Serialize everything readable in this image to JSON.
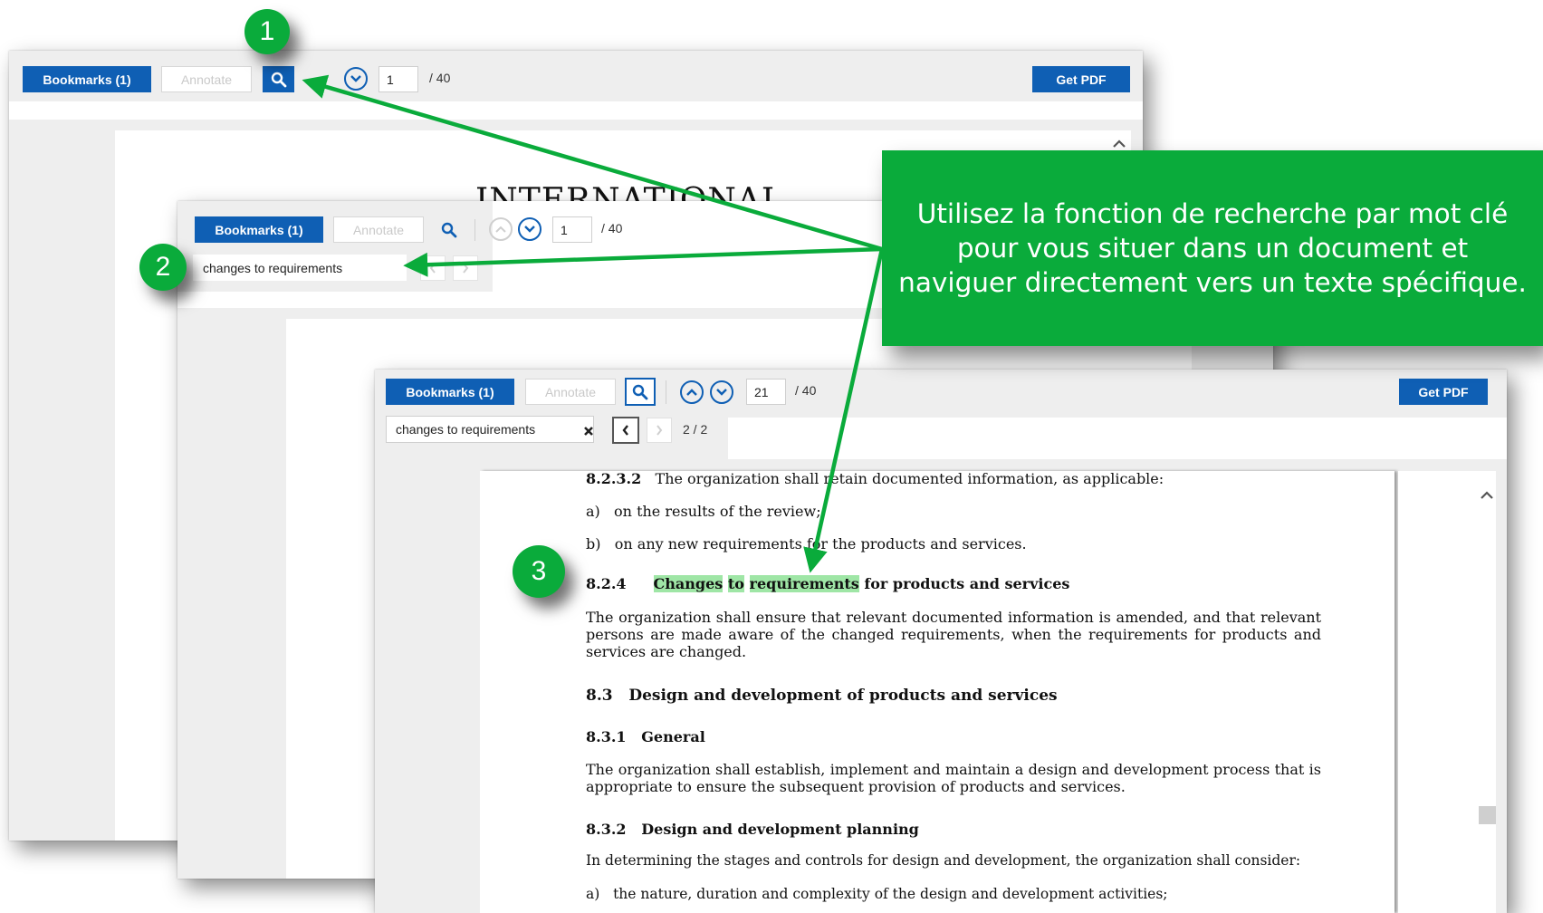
{
  "toolbar": {
    "bookmarks_label": "Bookmarks (1)",
    "annotate_label": "Annotate",
    "get_pdf_label": "Get PDF",
    "page_separator": "/ 40"
  },
  "window1": {
    "page_value": "1",
    "doc_title_fragment": "INTERNATIONAL"
  },
  "window2": {
    "page_value": "1",
    "search_value": "changes to requirements"
  },
  "window3": {
    "page_value": "21",
    "search_value": "changes to requirements",
    "match_count": "2 / 2"
  },
  "document": {
    "l1_num": "8.2.3.2",
    "l1_text": "The organization shall retain documented information, as applicable:",
    "l2_mark": "a)",
    "l2_text": "on the results of the review;",
    "l3_mark": "b)",
    "l3_text": "on any new requirements for the products and services.",
    "h824_num": "8.2.4",
    "h824_hl1": "Changes",
    "h824_hl2": "to",
    "h824_hl3": "requirements",
    "h824_rest": "for products and services",
    "p824": "The organization shall ensure that relevant documented information is amended, and that relevant persons are made aware of the changed requirements, when the requirements for products and services are changed.",
    "h83_num": "8.3",
    "h83_text": "Design and development of products and services",
    "h831_num": "8.3.1",
    "h831_text": "General",
    "p831": "The organization shall establish, implement and maintain a design and development process that is appropriate to ensure the subsequent provision of products and services.",
    "h832_num": "8.3.2",
    "h832_text": "Design and development planning",
    "p832": "In determining the stages and controls for design and development, the organization shall consider:",
    "l_last_mark": "a)",
    "l_last_text": "the nature, duration and complexity of the design and development activities;"
  },
  "callout": {
    "text": "Utilisez la fonction de recherche par mot clé pour vous situer dans un document et naviguer directement vers un texte spécifique."
  },
  "badges": [
    "1",
    "2",
    "3"
  ],
  "colors": {
    "accent_green": "#0aab3b",
    "toolbar_blue": "#0f5fb4",
    "highlight": "#9fe6a6"
  },
  "icons": [
    "search-icon",
    "chevron-up-icon",
    "chevron-down-icon",
    "close-icon",
    "chevron-left-icon",
    "chevron-right-icon"
  ]
}
